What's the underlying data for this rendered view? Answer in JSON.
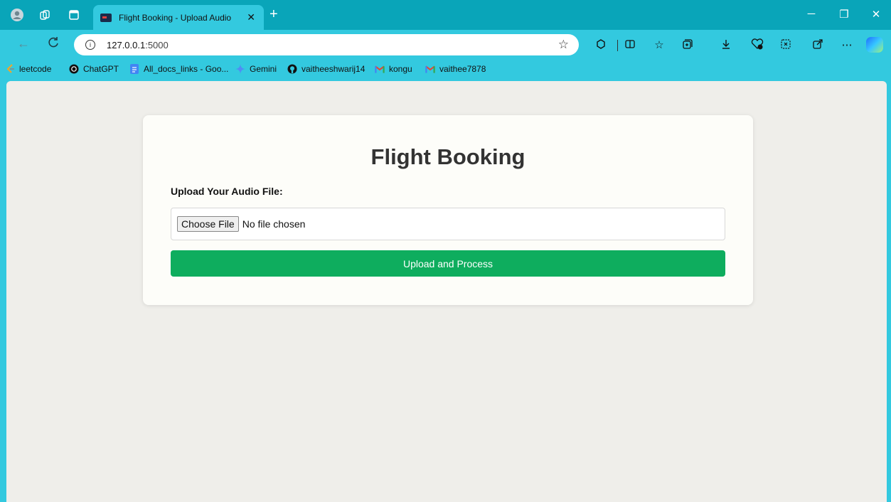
{
  "browser": {
    "tab": {
      "title": "Flight Booking - Upload Audio",
      "close": "✕"
    },
    "new_tab": "+",
    "window": {
      "minimize": "─",
      "restore": "❐",
      "close": "✕"
    },
    "address": {
      "host": "127.0.0.1",
      "port": ":5000"
    },
    "bookmarks": [
      {
        "label": "leetcode",
        "icon": "leetcode-icon",
        "color": "#f5a623"
      },
      {
        "label": "ChatGPT",
        "icon": "chatgpt-icon",
        "color": "#111111"
      },
      {
        "label": "All_docs_links - Goo...",
        "icon": "docs-icon",
        "color": "#4285f4"
      },
      {
        "label": "Gemini",
        "icon": "gemini-icon",
        "color": "#4f8df5"
      },
      {
        "label": "vaitheeshwarij14",
        "icon": "github-icon",
        "color": "#111111"
      },
      {
        "label": "kongu",
        "icon": "gmail-icon",
        "color": "#ea4335"
      },
      {
        "label": "vaithee7878",
        "icon": "gmail-icon",
        "color": "#ea4335"
      }
    ]
  },
  "page": {
    "title": "Flight Booking",
    "upload_label": "Upload Your Audio File:",
    "file_button": "Choose File",
    "file_status": "No file chosen",
    "submit": "Upload and Process"
  },
  "colors": {
    "tabbar": "#09a5b9",
    "chrome": "#33c9df",
    "page_bg": "#efeeea",
    "card_bg": "#fdfdf9",
    "button": "#0ead5e"
  }
}
